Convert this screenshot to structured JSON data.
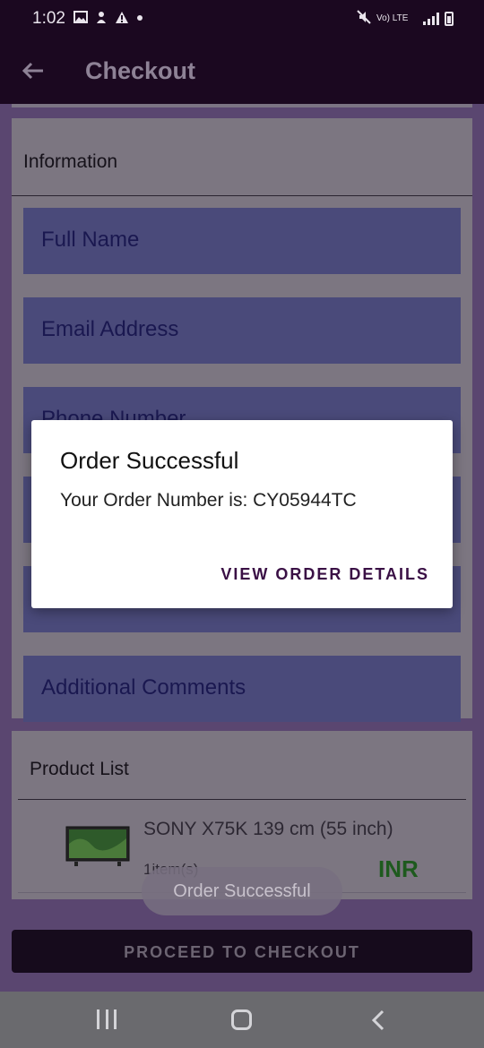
{
  "status_bar": {
    "time": "1:02",
    "network_label": "Vo) LTE",
    "network_sub": "LTE1"
  },
  "app_bar": {
    "title": "Checkout",
    "back_icon": "arrow-left-icon"
  },
  "information": {
    "header": "Information",
    "fields": [
      {
        "label": "Full Name"
      },
      {
        "label": "Email Address"
      },
      {
        "label": "Phone Number"
      },
      {
        "label": "Additional Comments"
      }
    ]
  },
  "product_list": {
    "header": "Product List",
    "items": [
      {
        "name": "SONY X75K 139 cm (55 inch)",
        "quantity": "1item(s)",
        "price": "INR"
      }
    ]
  },
  "toast": {
    "text": "Order Successful"
  },
  "checkout_button": {
    "label": "PROCEED TO CHECKOUT"
  },
  "dialog": {
    "title": "Order Successful",
    "message": "Your Order Number is: CY05944TC",
    "action": "VIEW ORDER DETAILS"
  },
  "colors": {
    "app_bar": "#1b0820",
    "dialog_action": "#3a1045",
    "price": "#1e5a1e"
  }
}
